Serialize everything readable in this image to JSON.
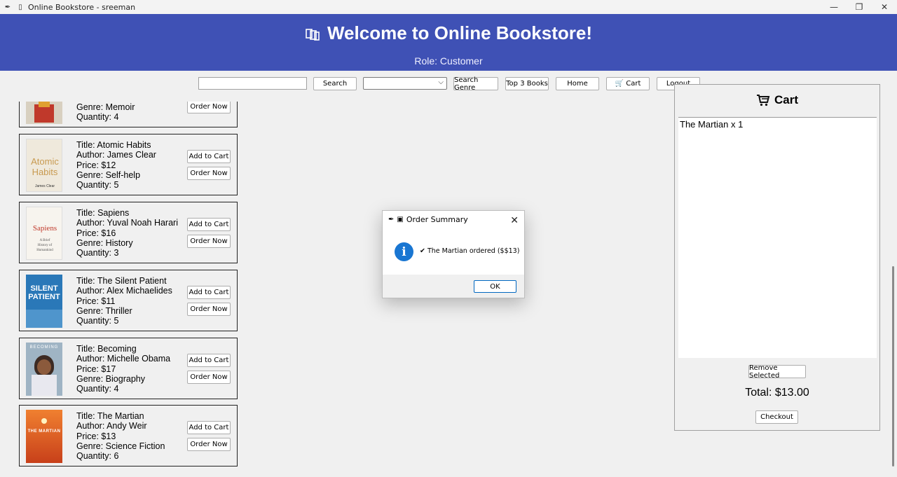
{
  "window": {
    "title": "Online Bookstore - sreeman",
    "minimize_glyph": "—",
    "maximize_glyph": "❐",
    "close_glyph": "✕"
  },
  "header": {
    "title": "Welcome to Online Bookstore!",
    "role": "Role: Customer",
    "icon": "books-icon"
  },
  "toolbar": {
    "search_value": "",
    "search_label": "Search",
    "genre_selected": "",
    "search_genre_label": "Search Genre",
    "top3_label": "Top 3 Books",
    "home_label": "Home",
    "cart_label": "🛒 Cart",
    "logout_label": "Logout"
  },
  "books": [
    {
      "title": "",
      "author": "",
      "price": "",
      "genre": "Genre: Memoir",
      "quantity": "Quantity: 4",
      "add_label": "",
      "order_label": "Order Now",
      "cover_color": "#b8342a"
    },
    {
      "title": "Title: Atomic Habits",
      "author": "Author: James Clear",
      "price": "Price: $12",
      "genre": "Genre: Self-help",
      "quantity": "Quantity: 5",
      "add_label": "Add to Cart",
      "order_label": "Order Now",
      "cover_color": "#efe9dc",
      "cover_text": "Atomic Habits"
    },
    {
      "title": "Title: Sapiens",
      "author": "Author: Yuval Noah Harari",
      "price": "Price: $16",
      "genre": "Genre: History",
      "quantity": "Quantity: 3",
      "add_label": "Add to Cart",
      "order_label": "Order Now",
      "cover_color": "#f7f4ee",
      "cover_text": "Sapiens"
    },
    {
      "title": "Title: The Silent Patient",
      "author": "Author: Alex Michaelides",
      "price": "Price: $11",
      "genre": "Genre: Thriller",
      "quantity": "Quantity: 5",
      "add_label": "Add to Cart",
      "order_label": "Order Now",
      "cover_color": "#2a78b8",
      "cover_text": "SILENT PATIENT"
    },
    {
      "title": "Title: Becoming",
      "author": "Author: Michelle Obama",
      "price": "Price: $17",
      "genre": "Genre: Biography",
      "quantity": "Quantity: 4",
      "add_label": "Add to Cart",
      "order_label": "Order Now",
      "cover_color": "#9fb4c4",
      "cover_text": "BECOMING"
    },
    {
      "title": "Title: The Martian",
      "author": "Author: Andy Weir",
      "price": "Price: $13",
      "genre": "Genre: Science Fiction",
      "quantity": "Quantity: 6",
      "add_label": "Add to Cart",
      "order_label": "Order Now",
      "cover_color": "#e0582a",
      "cover_text": "THE MARTIAN"
    }
  ],
  "cart": {
    "title": "Cart",
    "items": [
      "The Martian x 1"
    ],
    "remove_label": "Remove Selected",
    "total": "Total: $13.00",
    "checkout_label": "Checkout"
  },
  "dialog": {
    "title": "Order Summary",
    "message": "✔ The Martian ordered ($$13)",
    "ok_label": "OK",
    "close_glyph": "✕"
  }
}
